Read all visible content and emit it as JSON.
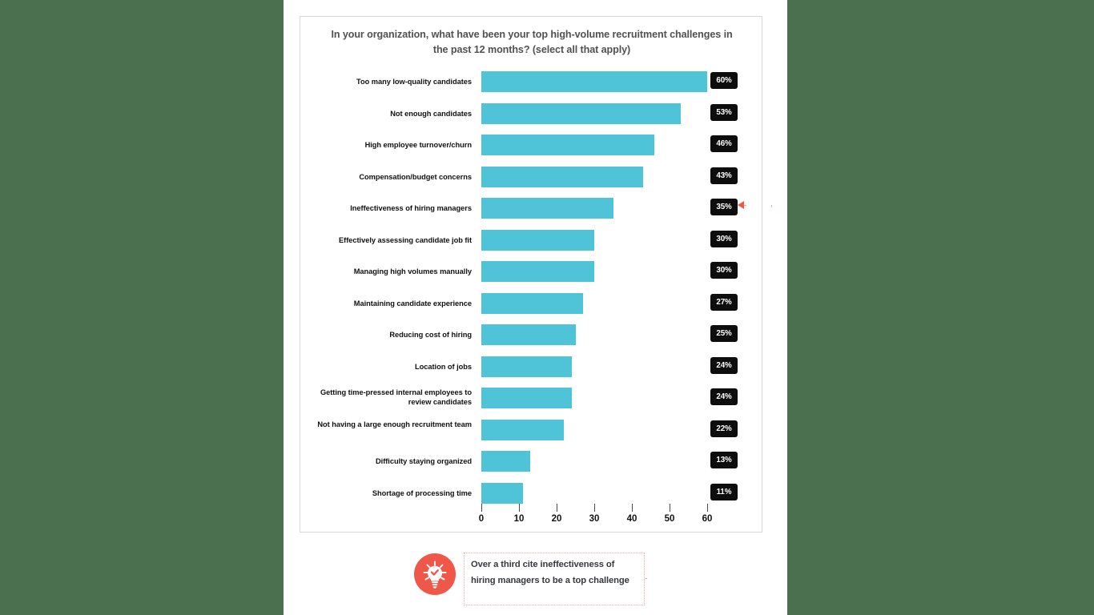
{
  "chart_data": {
    "type": "bar",
    "orientation": "horizontal",
    "title": "In your organization, what have been your top high-volume recruitment challenges in the past 12 months? (select all that apply)",
    "xlabel": "",
    "ylabel": "",
    "xlim": [
      0,
      60
    ],
    "xticks": [
      "0",
      "10",
      "20",
      "30",
      "40",
      "50",
      "60"
    ],
    "grid": false,
    "legend": "none",
    "bar_color": "#4fc4d8",
    "value_suffix": "%",
    "categories": [
      "Too many low-quality candidates",
      "Not enough candidates",
      "High employee turnover/churn",
      "Compensation/budget concerns",
      "Ineffectiveness of hiring managers",
      "Effectively assessing candidate job fit",
      "Managing high volumes manually",
      "Maintaining  candidate experience",
      "Reducing cost of hiring",
      "Location of jobs",
      "Getting time-pressed internal employees to review candidates",
      "Not having a large enough recruitment team",
      "Difficulty staying organized",
      "Shortage of processing time"
    ],
    "values": [
      60,
      53,
      46,
      43,
      35,
      30,
      30,
      27,
      25,
      24,
      24,
      22,
      13,
      11
    ],
    "value_labels": [
      "60%",
      "53%",
      "46%",
      "43%",
      "35%",
      "30%",
      "30%",
      "27%",
      "25%",
      "24%",
      "24%",
      "22%",
      "13%",
      "11%"
    ],
    "annotation": {
      "text": "Over a third cite ineffectiveness of hiring managers to be a top challenge",
      "points_to_category": "Ineffectiveness of hiring managers",
      "icon": "lightbulb-check-icon",
      "accent_color": "#ef5749"
    }
  },
  "colors": {
    "background": "#4a7050",
    "page": "#ffffff",
    "bar": "#4fc4d8",
    "badge": "#0d0d0d",
    "title": "#515151",
    "accent": "#ef5749",
    "annotation_line": "#f3a8a1"
  }
}
